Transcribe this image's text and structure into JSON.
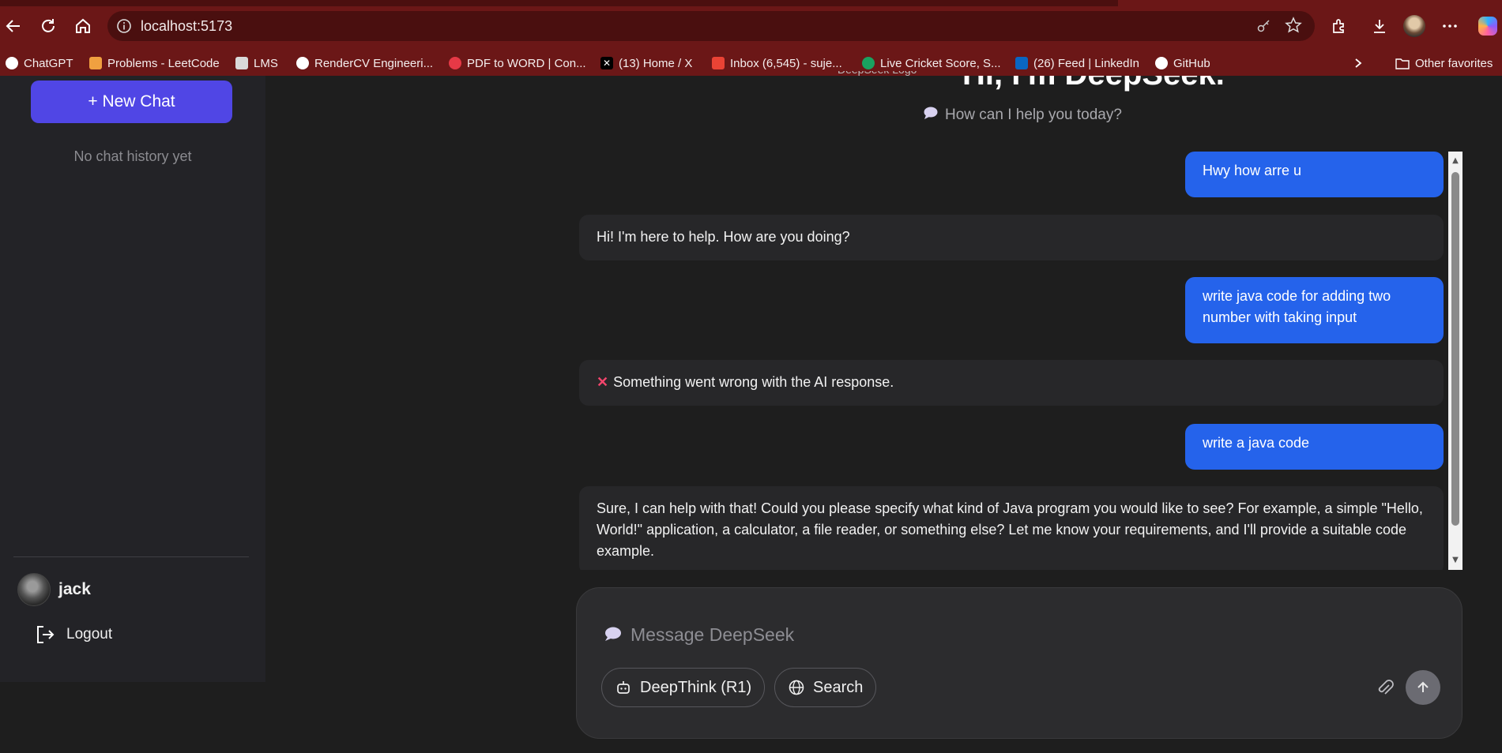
{
  "browser": {
    "url": "localhost:5173",
    "bookmarks": [
      {
        "label": "ChatGPT",
        "icon": "chatgpt-icon",
        "color": "#ffffff"
      },
      {
        "label": "Problems - LeetCode",
        "icon": "leetcode-icon",
        "color": "#f0a040"
      },
      {
        "label": "LMS",
        "icon": "lms-icon",
        "color": "#d9d9d9"
      },
      {
        "label": "RenderCV Engineeri...",
        "icon": "rendercv-icon",
        "color": "#ffffff"
      },
      {
        "label": "PDF to WORD | Con...",
        "icon": "pdf-icon",
        "color": "#e63946"
      },
      {
        "label": "(13) Home / X",
        "icon": "x-icon",
        "color": "#000000"
      },
      {
        "label": "Inbox (6,545) - suje...",
        "icon": "gmail-icon",
        "color": "#ea4335"
      },
      {
        "label": "Live Cricket Score, S...",
        "icon": "cricbuzz-icon",
        "color": "#1aa260"
      },
      {
        "label": "(26) Feed | LinkedIn",
        "icon": "linkedin-icon",
        "color": "#0a66c2"
      },
      {
        "label": "GitHub",
        "icon": "github-icon",
        "color": "#ffffff"
      }
    ],
    "other_favorites": "Other favorites"
  },
  "sidebar": {
    "new_chat": "+ New Chat",
    "empty_history": "No chat history yet",
    "user_name": "jack",
    "logout": "Logout"
  },
  "main": {
    "logo_alt": "DeepSeek Logo",
    "headline": "Hi, I'm DeepSeek.",
    "subheading": "How can I help you today?"
  },
  "messages": [
    {
      "role": "user",
      "text": "Hwy how arre u"
    },
    {
      "role": "assistant",
      "text": "Hi! I'm here to help. How are you doing?"
    },
    {
      "role": "user",
      "text": "write java code for adding two number with taking input"
    },
    {
      "role": "error",
      "icon": "error-x-icon",
      "text": "Something went wrong with the AI response."
    },
    {
      "role": "user",
      "text": "write a java code"
    },
    {
      "role": "assistant",
      "text": "Sure, I can help with that! Could you please specify what kind of Java program you would like to see? For example, a simple \"Hello, World!\" application, a calculator, a file reader, or something else? Let me know your requirements, and I'll provide a suitable code example."
    }
  ],
  "composer": {
    "placeholder": "Message DeepSeek",
    "deepthink_label": "DeepThink (R1)",
    "search_label": "Search"
  },
  "colors": {
    "accent": "#5046e5",
    "user_bubble": "#2563eb",
    "browser_frame": "#6b1717",
    "error": "#f3456c"
  }
}
